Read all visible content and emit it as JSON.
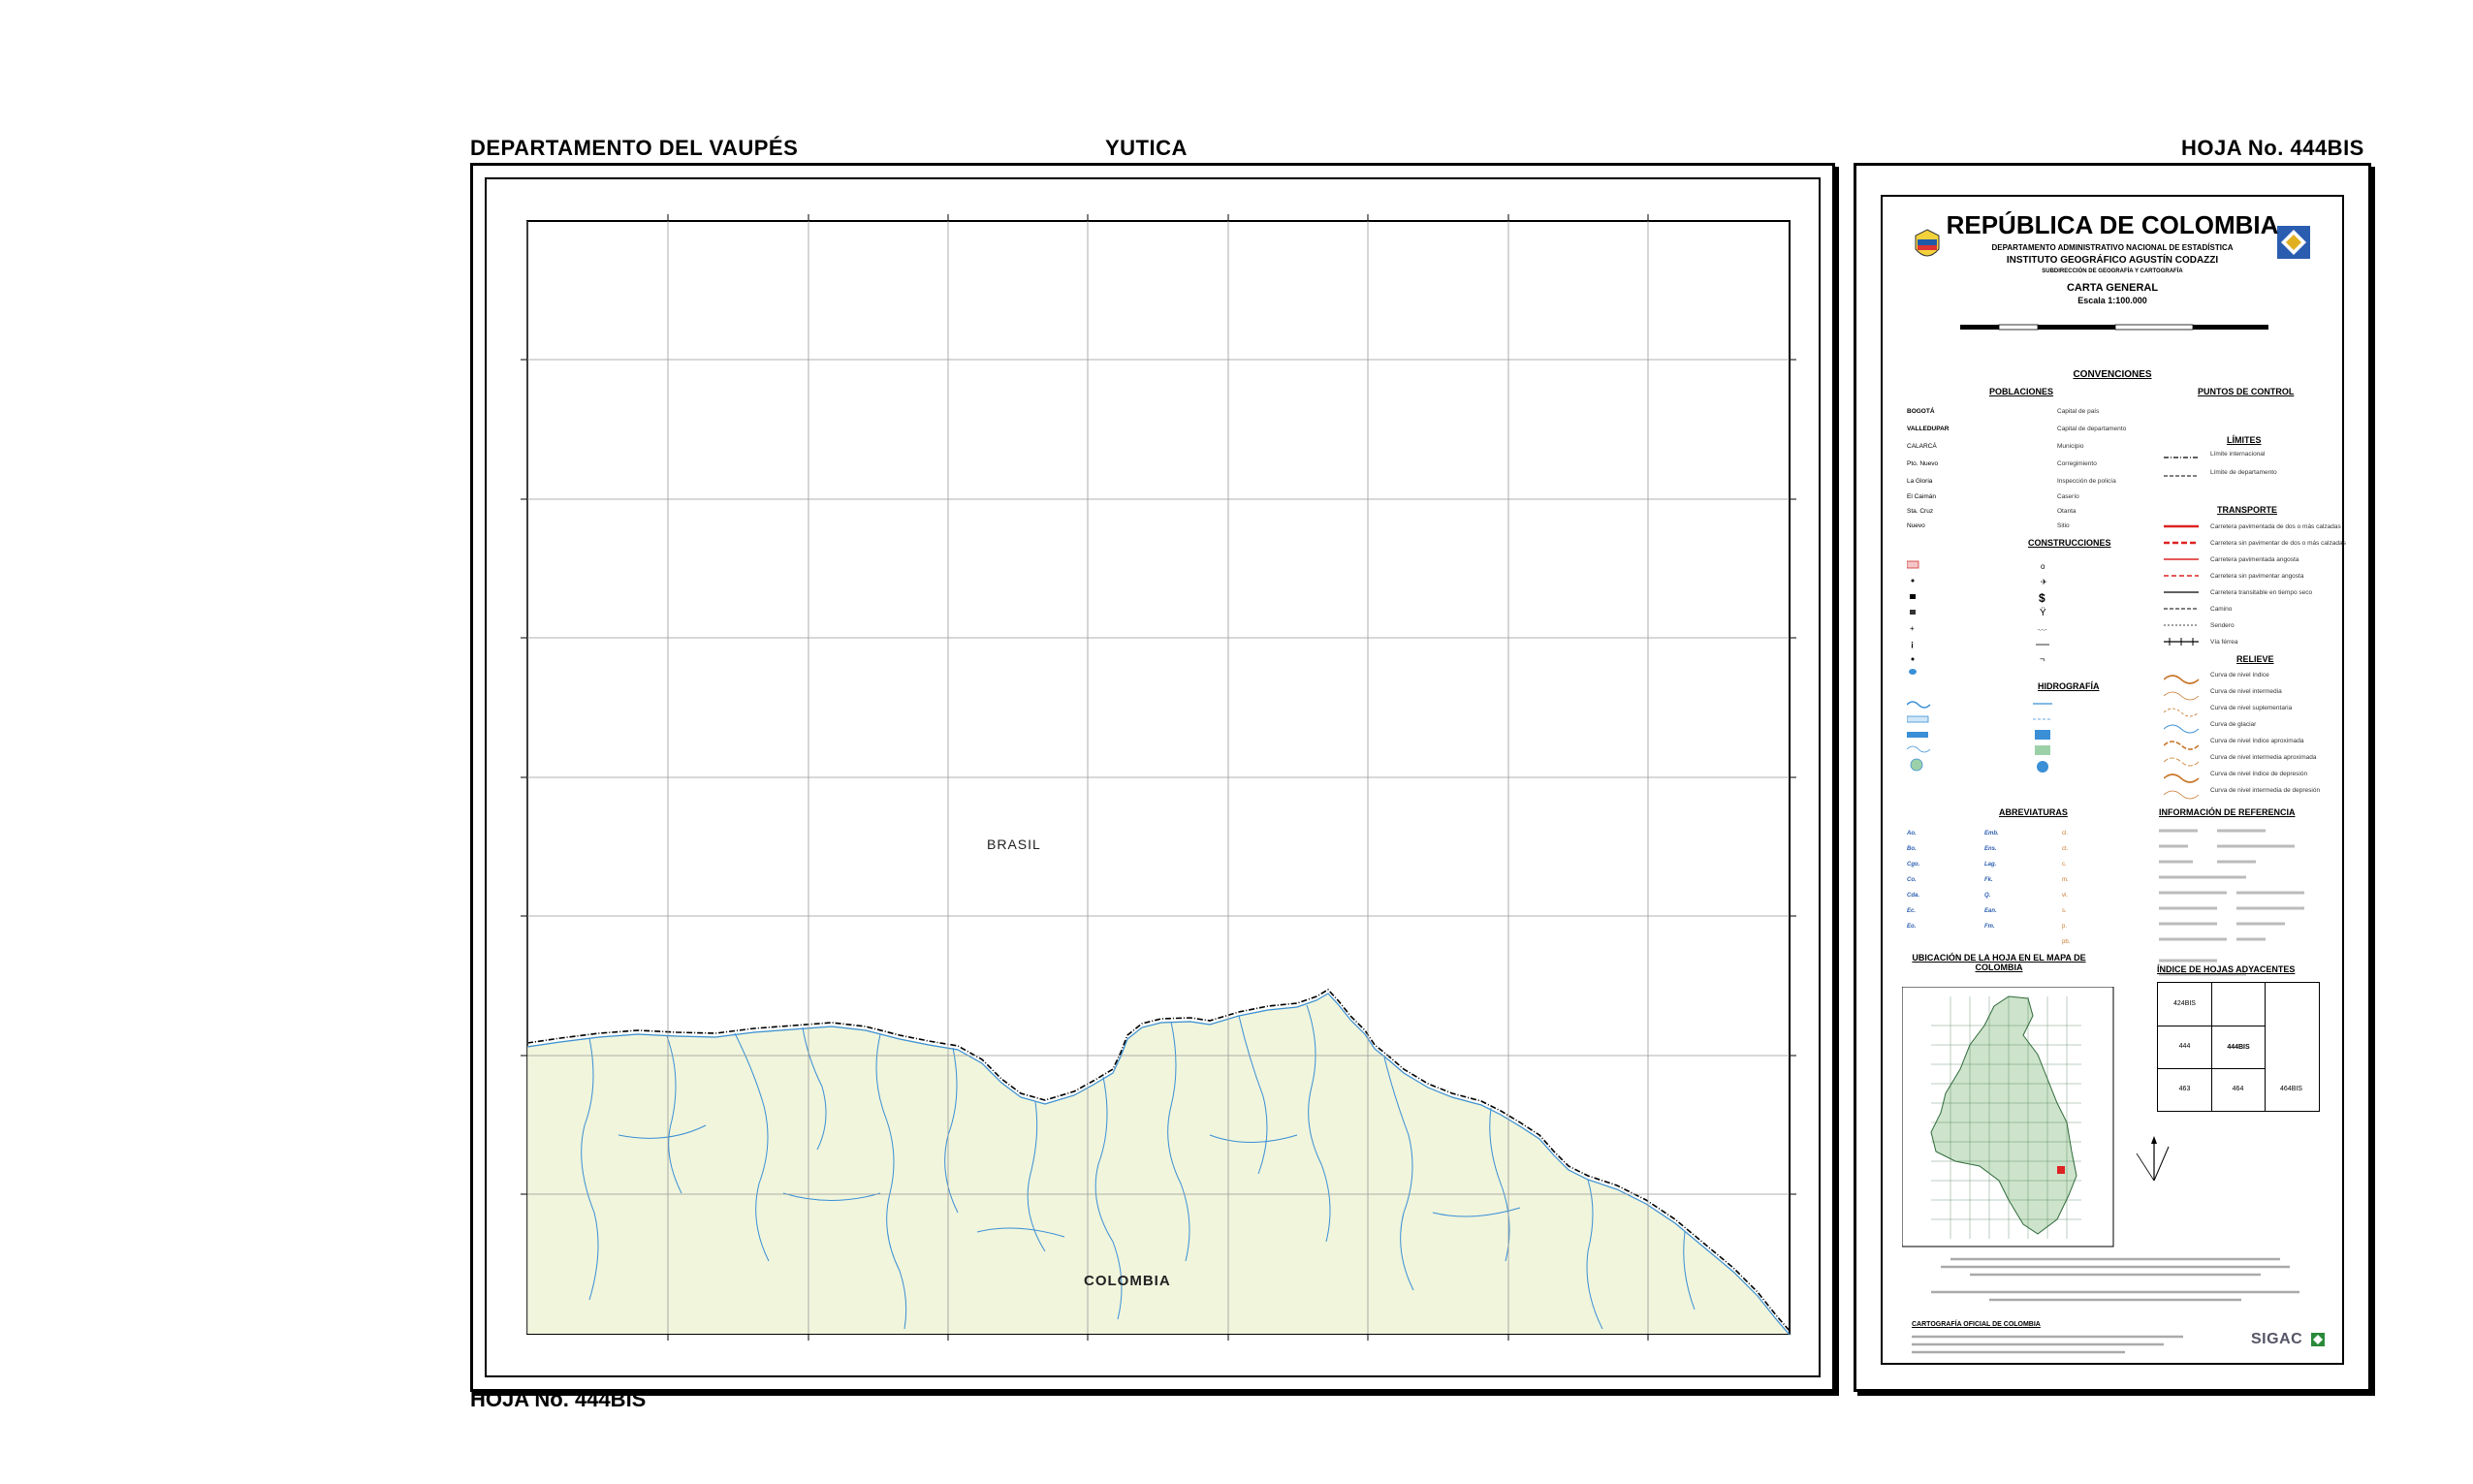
{
  "header": {
    "department": "DEPARTAMENTO DEL VAUPÉS",
    "sheet_name": "YUTICA",
    "sheet_number": "HOJA No. 444BIS"
  },
  "footer": {
    "sheet_number": "HOJA No. 444BIS"
  },
  "map": {
    "labels": {
      "brasil": "BRASIL",
      "colombia": "COLOMBIA"
    },
    "colors": {
      "land": "#f0f5dc",
      "river": "#3a8fd6",
      "grid": "#999999",
      "border": "#000000"
    }
  },
  "legend": {
    "title": "REPÚBLICA DE COLOMBIA",
    "dept": "DEPARTAMENTO ADMINISTRATIVO NACIONAL DE ESTADÍSTICA",
    "institute": "INSTITUTO GEOGRÁFICO AGUSTÍN CODAZZI",
    "subdir": "SUBDIRECCIÓN DE GEOGRAFÍA Y CARTOGRAFÍA",
    "carta": "CARTA GENERAL",
    "scale": "Escala 1:100.000",
    "sections": {
      "convenciones": "CONVENCIONES",
      "poblaciones": "POBLACIONES",
      "puntos_control": "PUNTOS DE CONTROL",
      "limites": "LÍMITES",
      "transporte": "TRANSPORTE",
      "construcciones": "CONSTRUCCIONES",
      "relieve": "RELIEVE",
      "hidrografia": "HIDROGRAFÍA",
      "abreviaturas": "ABREVIATURAS",
      "info_referencia": "INFORMACIÓN DE REFERENCIA",
      "ubicacion": "UBICACIÓN DE LA HOJA EN EL MAPA DE COLOMBIA",
      "indice": "ÍNDICE DE HOJAS ADYACENTES"
    },
    "poblaciones": [
      {
        "name": "BOGOTÁ",
        "desc": "Capital de país"
      },
      {
        "name": "VALLEDUPAR",
        "desc": "Capital de departamento"
      },
      {
        "name": "CALARCÁ",
        "desc": "Municipio"
      },
      {
        "name": "Pto. Nuevo",
        "desc": "Corregimiento"
      },
      {
        "name": "La Gloria",
        "desc": "Inspección de policía"
      },
      {
        "name": "El Caimán",
        "desc": "Caserío"
      },
      {
        "name": "Sta. Cruz",
        "desc": "Otanta"
      },
      {
        "name": "Nuevo",
        "desc": "Sitio"
      }
    ],
    "limites": [
      "Límite internacional",
      "Límite de departamento"
    ],
    "transporte": [
      "Carretera pavimentada de dos o más calzadas",
      "Carretera sin pavimentar de dos o más calzadas",
      "Carretera pavimentada angosta",
      "Carretera sin pavimentar angosta",
      "Carretera transitable en tiempo seco",
      "Camino",
      "Sendero",
      "Vía férrea"
    ],
    "relieve": [
      "Curva de nivel índice",
      "Curva de nivel intermedia",
      "Curva de nivel suplementaria",
      "Curva de glaciar",
      "Curva de nivel índice aproximada",
      "Curva de nivel intermedia aproximada",
      "Curva de nivel índice de depresión",
      "Curva de nivel intermedia de depresión"
    ],
    "adjacent": {
      "top": "424BIS",
      "left": "444",
      "center": "444BIS",
      "bottom_left": "463",
      "bottom_mid": "464",
      "bottom_right": "464BIS"
    },
    "sigac": "SIGAC",
    "cartografia_oficial": "CARTOGRAFÍA OFICIAL DE COLOMBIA"
  }
}
